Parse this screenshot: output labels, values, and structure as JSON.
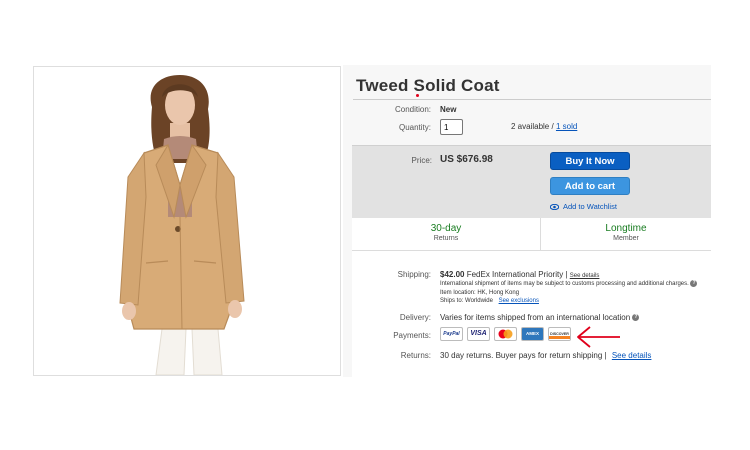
{
  "product": {
    "title": "Tweed Solid Coat",
    "image_alt": "woman-wearing-camel-coat"
  },
  "condition": {
    "label": "Condition:",
    "value": "New"
  },
  "quantity": {
    "label": "Quantity:",
    "value": "1",
    "available": "2 available",
    "separator": "/",
    "sold": "1 sold"
  },
  "price": {
    "label": "Price:",
    "value": "US $676.98"
  },
  "actions": {
    "buy_now": "Buy It Now",
    "add_to_cart": "Add to cart",
    "watchlist": "Add to Watchlist"
  },
  "badges": [
    {
      "title": "30-day",
      "subtitle": "Returns"
    },
    {
      "title": "Longtime",
      "subtitle": "Member"
    }
  ],
  "shipping": {
    "label": "Shipping:",
    "cost": "$42.00",
    "method": "FedEx International Priority |",
    "details_link": "See details",
    "note": "International shipment of items may be subject to customs processing and additional charges.",
    "location": "Item location:  HK, Hong Kong",
    "ships_to": "Ships to:  Worldwide",
    "exclusions_link": "See exclusions"
  },
  "delivery": {
    "label": "Delivery:",
    "value": "Varies for items shipped from an international location"
  },
  "payments": {
    "label": "Payments:",
    "methods": [
      {
        "name": "PayPal",
        "text": "PayPal",
        "color": "#1a3a8c"
      },
      {
        "name": "VISA",
        "text": "VISA",
        "color": "#1a1f71"
      },
      {
        "name": "Mastercard",
        "text": "",
        "color": "#eb001b"
      },
      {
        "name": "American Express",
        "text": "AMEX",
        "color": "#2e77bc"
      },
      {
        "name": "Discover",
        "text": "DISCOVER",
        "color": "#f58220"
      }
    ]
  },
  "returns": {
    "label": "Returns:",
    "value": "30 day returns. Buyer pays for return shipping |",
    "details_link": "See details"
  },
  "colors": {
    "primary_button": "#0a5fc2",
    "secondary_button": "#3c95e0",
    "link": "#0654ba",
    "badge_green": "#187c20",
    "annotation_arrow": "#e0001b"
  }
}
